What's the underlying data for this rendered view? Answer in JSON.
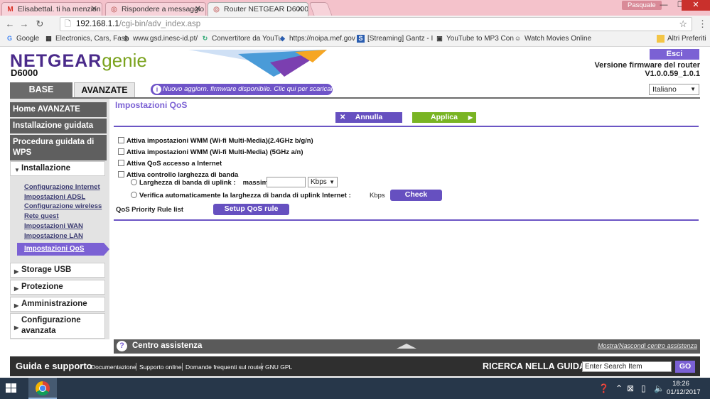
{
  "browser": {
    "tabs": [
      {
        "title": "Elisabettal. ti ha menzion",
        "icon": "M"
      },
      {
        "title": "Rispondere a messaggio",
        "icon": "◎"
      },
      {
        "title": "Router NETGEAR D6000",
        "icon": "◎"
      }
    ],
    "user": "Pasquale",
    "url_host": "192.168.1.1",
    "url_path": "/cgi-bin/adv_index.asp",
    "bookmarks": [
      {
        "label": "Google",
        "icon": "G"
      },
      {
        "label": "Electronics, Cars, Fash",
        "icon": "▦"
      },
      {
        "label": "www.gsd.inesc-id.pt/",
        "icon": "◎"
      },
      {
        "label": "Convertitore da YouTu",
        "icon": "↻"
      },
      {
        "label": "https://noipa.mef.gov",
        "icon": "◆"
      },
      {
        "label": "[Streaming] Gantz - I",
        "icon": "S"
      },
      {
        "label": "YouTube to MP3 Con",
        "icon": "▣"
      },
      {
        "label": "Watch Movies Online",
        "icon": "☺"
      }
    ],
    "other_bookmarks": "Altri Preferiti"
  },
  "router": {
    "logo_brand": "NETGEAR",
    "logo_product": "genie",
    "model": "D6000",
    "logout": "Esci",
    "fw_title": "Versione firmware del router",
    "fw_version": "V1.0.0.59_1.0.1",
    "tab_base": "BASE",
    "tab_advanced": "AVANZATE",
    "update_notice": "Nuovo aggiorn. firmware disponibile. Clic qui per scaricarlo.",
    "language": "Italiano",
    "colors": {
      "accent": "#7b61d4",
      "apply": "#79b423",
      "dark": "#5f5f5f"
    }
  },
  "sidebar": {
    "home": "Home AVANZATE",
    "setup_wizard": "Installazione guidata",
    "wps_wizard": "Procedura guidata di WPS",
    "installazione": "Installazione",
    "links": [
      "Configurazione Internet",
      "Impostazioni ADSL",
      "Configurazione wireless",
      "Rete guest",
      "Impostazioni WAN",
      "Impostazione LAN"
    ],
    "active": "Impostazioni QoS",
    "sections": [
      "Storage USB",
      "Protezione",
      "Amministrazione",
      "Configurazione avanzata"
    ]
  },
  "main": {
    "title": "Impostazioni QoS",
    "cancel": "Annulla",
    "apply": "Applica",
    "wmm_24": "Attiva impostazioni WMM (Wi-fi Multi-Media)(2.4GHz b/g/n)",
    "wmm_5": "Attiva impostazioni WMM (Wi-fi Multi-Media) (5GHz a/n)",
    "qos_internet": "Attiva QoS accesso a Internet",
    "bw_control": "Attiva controllo larghezza di banda",
    "uplink_label": "Larghezza di banda di uplink :",
    "massima": "massima",
    "uplink_value": "",
    "unit": "Kbps",
    "auto_check": "Verifica automaticamente la larghezza di banda di uplink Internet :",
    "kbps": "Kbps",
    "check": "Check",
    "qos_rule_label": "QoS Priority Rule list",
    "setup_rule": "Setup QoS rule"
  },
  "help": {
    "title": "Centro assistenza",
    "toggle": "Mostra/Nascondi centro assistenza"
  },
  "footer": {
    "title": "Guida e supporto",
    "links": [
      "Documentazione",
      "Supporto online",
      "Domande frequenti sul router",
      "GNU GPL"
    ],
    "search_title": "RICERCA NELLA GUIDA",
    "search_placeholder": "Enter Search Item",
    "go": "GO"
  },
  "taskbar": {
    "time": "18:26",
    "date": "01/12/2017"
  }
}
